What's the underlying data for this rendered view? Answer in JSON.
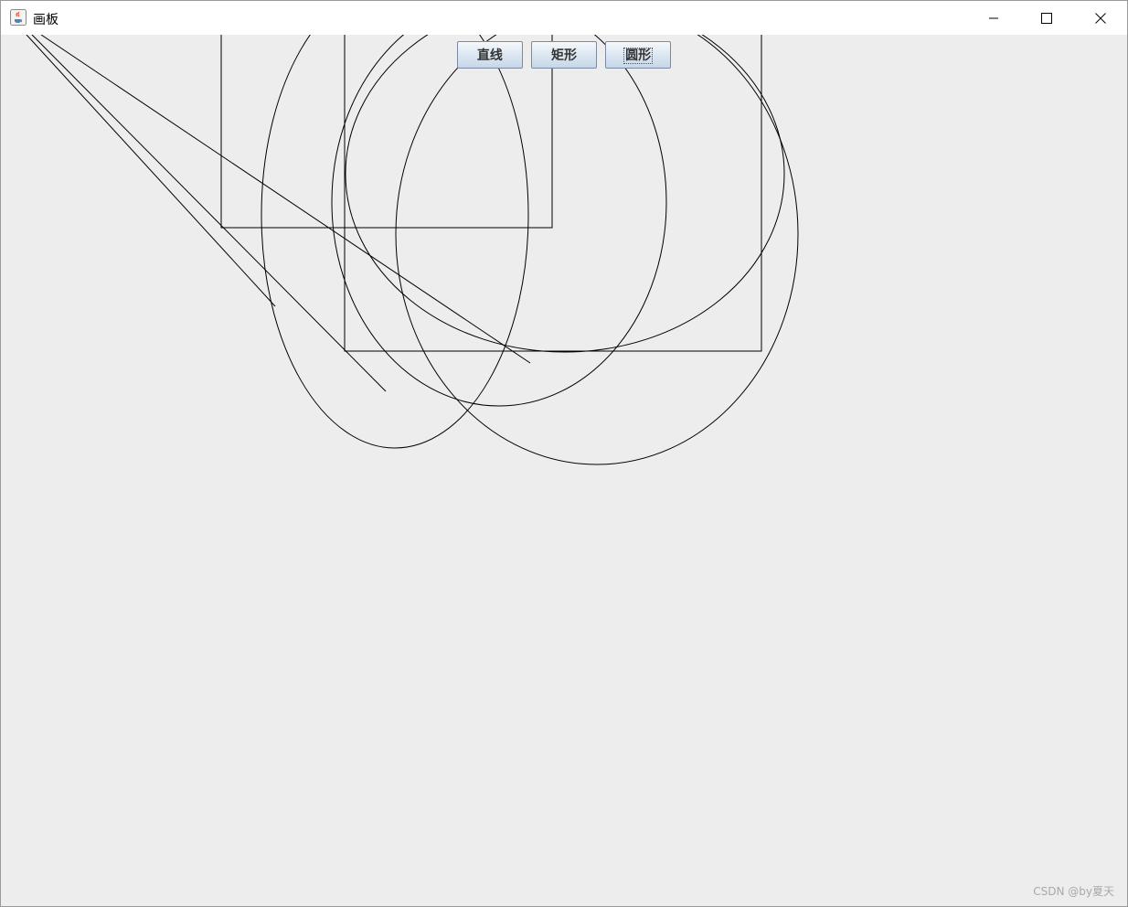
{
  "window": {
    "title": "画板",
    "controls": {
      "minimize": "minimize-icon",
      "maximize": "maximize-icon",
      "close": "close-icon"
    }
  },
  "toolbar": {
    "buttons": [
      {
        "label": "直线"
      },
      {
        "label": "矩形"
      },
      {
        "label": "圆形"
      }
    ],
    "focused_index": 2
  },
  "drawing": {
    "stroke_color": "#000000"
  },
  "watermark": "CSDN @by夏天",
  "colors": {
    "canvas_bg": "#ededed",
    "titlebar_bg": "#ffffff",
    "accent_mark": "#e8642c"
  }
}
